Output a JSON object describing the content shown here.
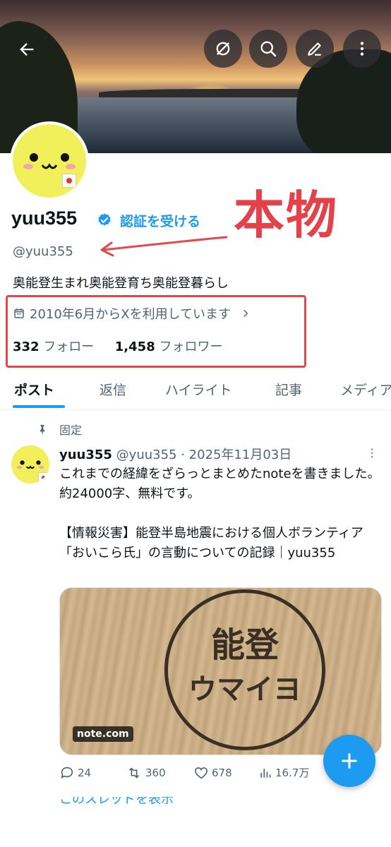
{
  "profile": {
    "name": "yuu355",
    "get_verified": "認証を受ける",
    "handle": "@yuu355",
    "bio": "奥能登生まれ奥能登育ち奥能登暮らし",
    "joined": "2010年6月からXを利用しています",
    "following_count": "332",
    "following_label": "フォロー",
    "followers_count": "1,458",
    "followers_label": "フォロワー"
  },
  "annotation": {
    "stamp": "本物",
    "color": "#e4424a"
  },
  "tabs": [
    "ポスト",
    "返信",
    "ハイライト",
    "記事",
    "メディア"
  ],
  "tweet": {
    "pinned_label": "固定",
    "author": "yuu355",
    "handle_date": "@yuu355 · 2025年11月03日",
    "text": "これまでの経緯をざらっとまとめたnoteを書きました。約24000字、無料です。\n\n【情報災害】能登半島地震における個人ボランティア「おいこら氏」の言動についての記録｜yuu355",
    "card": {
      "logo_line1": "能登",
      "logo_line2": "ウマイヨ",
      "domain": "note.com"
    },
    "replies": "24",
    "reposts": "360",
    "likes": "678",
    "views": "16.7万",
    "show_more": "このスレッドを表示"
  },
  "icons": {
    "header": [
      "back-arrow-icon",
      "grok-icon",
      "search-icon",
      "edit-icon",
      "more-icon"
    ],
    "compose": "plus-icon"
  },
  "colors": {
    "accent": "#1d9bf0",
    "text": "#0f1419",
    "secondary": "#536471"
  }
}
